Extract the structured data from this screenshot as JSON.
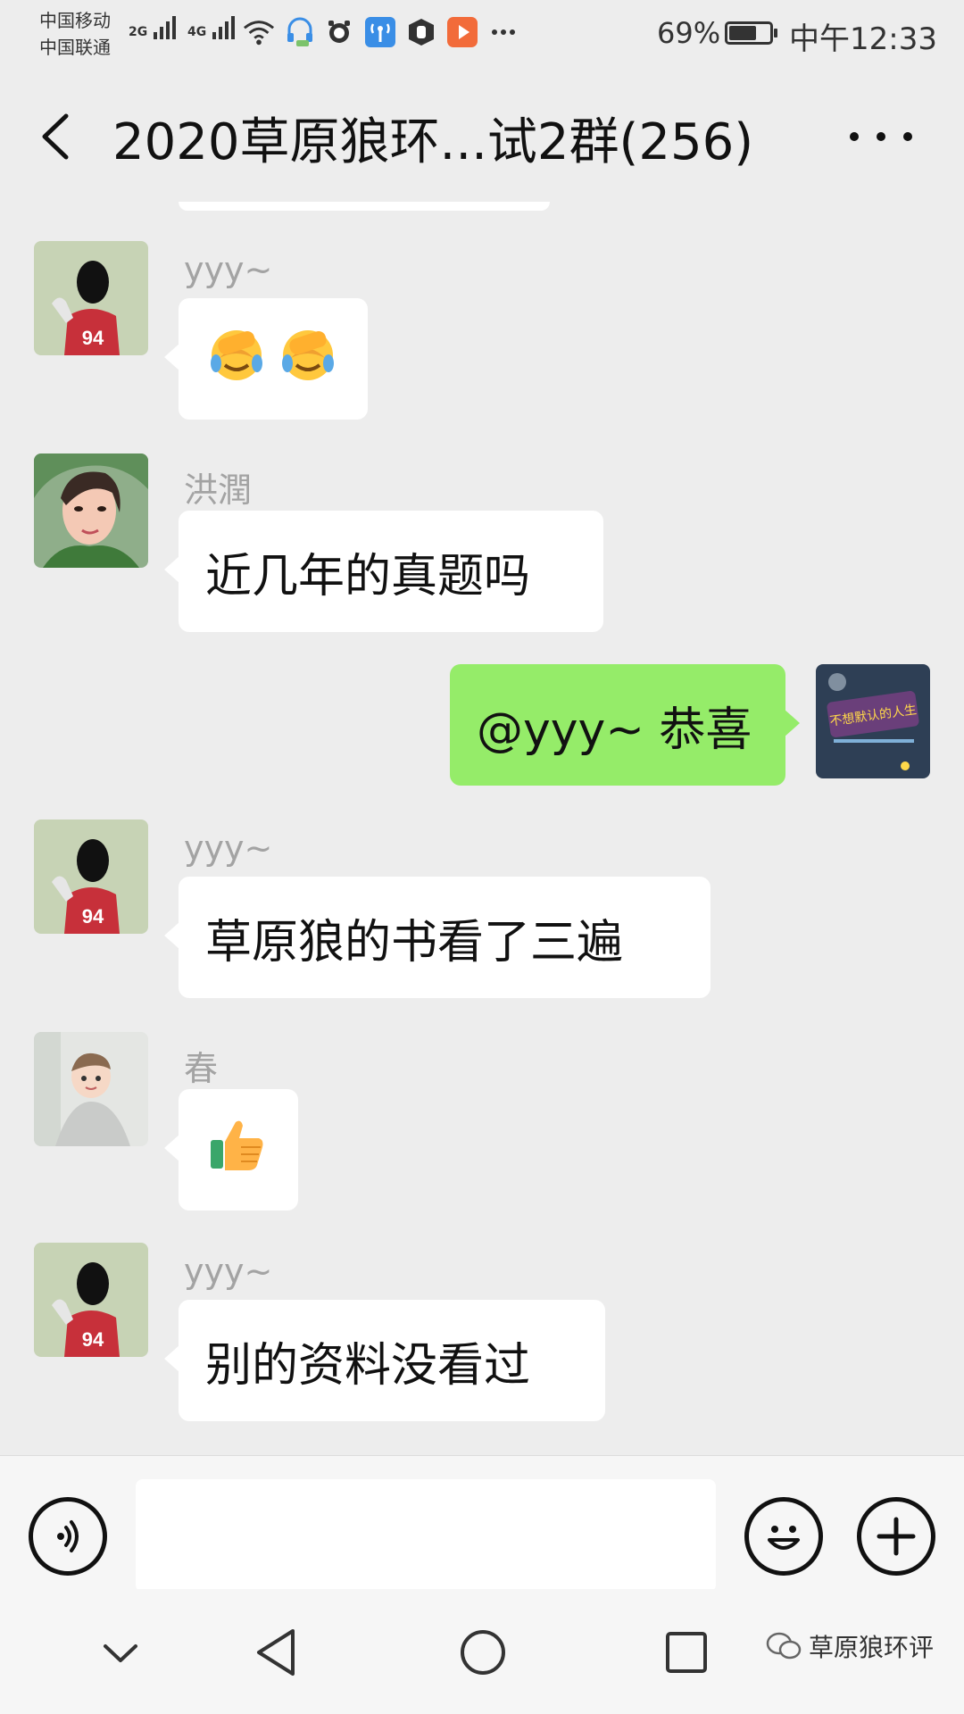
{
  "status_bar": {
    "carrier_1": "中国移动",
    "carrier_2": "中国联通",
    "network_1": "2G",
    "network_2": "4G",
    "battery_percent": "69%",
    "battery_level": 0.69,
    "time": "中午12:33",
    "icons": [
      "wifi-icon",
      "headset-app-icon",
      "alarm-icon",
      "wireless-app-icon",
      "shield-app-icon",
      "video-app-icon",
      "more-notifications-icon"
    ]
  },
  "nav": {
    "title": "2020草原狼环...试2群(256)",
    "back_icon": "back-arrow-icon",
    "more_icon": "more-dots-icon"
  },
  "messages": [
    {
      "side": "left",
      "sender": "yyy~",
      "text": "",
      "emoji": [
        "facepalm-emoji",
        "facepalm-emoji"
      ]
    },
    {
      "side": "left",
      "sender": "洪潤",
      "text": "近几年的真题吗"
    },
    {
      "side": "right",
      "sender": "",
      "text": "@yyy~ 恭喜"
    },
    {
      "side": "left",
      "sender": "yyy~",
      "text": "草原狼的书看了三遍"
    },
    {
      "side": "left",
      "sender": "春",
      "text": "",
      "emoji": [
        "thumbs-up-emoji"
      ]
    },
    {
      "side": "left",
      "sender": "yyy~",
      "text": "别的资料没看过"
    }
  ],
  "my_avatar_text": "不想默认的人生",
  "avatar_jersey_number": "94",
  "input_bar": {
    "placeholder": "",
    "voice_icon": "voice-icon",
    "emoji_icon": "emoji-smile-icon",
    "plus_icon": "plus-icon"
  },
  "system_nav": {
    "icons": [
      "collapse-chevron-icon",
      "back-triangle-icon",
      "home-circle-icon",
      "recents-square-icon"
    ],
    "watermark": "草原狼环评"
  },
  "colors": {
    "background": "#ededed",
    "my_bubble": "#95ec69",
    "other_bubble": "#ffffff",
    "sender_name": "#a3a3a3"
  }
}
